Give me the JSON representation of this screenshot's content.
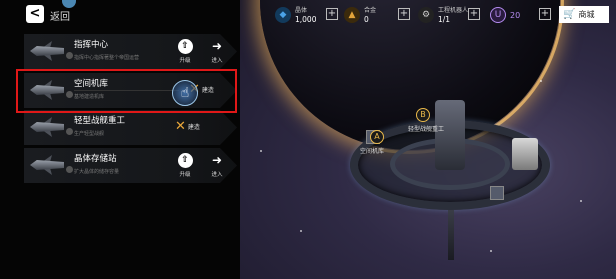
{
  "header": {
    "back_label": "返回"
  },
  "resources": [
    {
      "name": "晶体",
      "value": "1,000",
      "icon": "crystal-icon",
      "color": "#4aa3e8"
    },
    {
      "name": "合金",
      "value": "0",
      "icon": "alloy-icon",
      "color": "#e3a43a"
    },
    {
      "name": "工程机器人",
      "value": "1/1",
      "icon": "robot-icon",
      "color": "#cccccc"
    }
  ],
  "premium": {
    "value": "20",
    "icon": "premium-u-icon",
    "color": "#b58cf0"
  },
  "shop_label": "商城",
  "facilities": [
    {
      "title": "指挥中心",
      "desc": "指挥中心指挥著整个帝国运营",
      "action": "upgrade",
      "action_label": "升级",
      "enter_label": "进入"
    },
    {
      "title": "空间机库",
      "desc": "基地建造机库",
      "action": "build",
      "action_label": "建造",
      "enter_label": ""
    },
    {
      "title": "轻型战舰重工",
      "desc": "生产轻型战舰",
      "action": "build",
      "action_label": "建造",
      "enter_label": ""
    },
    {
      "title": "晶体存储站",
      "desc": "扩大晶体的储存容量",
      "action": "upgrade",
      "action_label": "升级",
      "enter_label": "进入"
    }
  ],
  "station_labels": {
    "marker_a": "A",
    "marker_b": "B",
    "label_a": "空间机库",
    "label_b": "轻型战舰重工"
  },
  "colors": {
    "highlight": "#e01818",
    "build_icon": "#e8a63a"
  }
}
